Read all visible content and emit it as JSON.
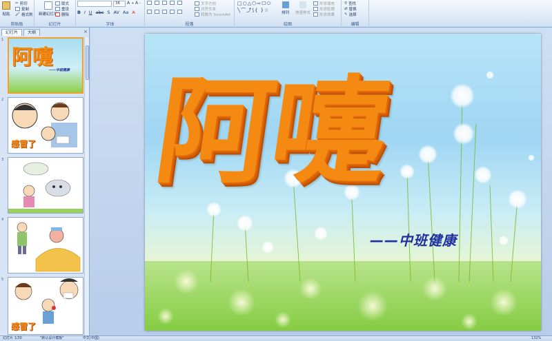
{
  "ribbon": {
    "groups": [
      {
        "label": "剪贴板",
        "items": [
          "粘贴",
          "剪切",
          "复制",
          "格式刷"
        ]
      },
      {
        "label": "幻灯片",
        "items": [
          "新建幻灯片",
          "版式",
          "重设",
          "删除"
        ]
      },
      {
        "label": "字体",
        "items": [
          "36"
        ]
      },
      {
        "label": "段落",
        "items": [
          "文字方向",
          "对齐文本",
          "转换为 SmartArt"
        ]
      },
      {
        "label": "绘图",
        "items": [
          "排列",
          "快速样式",
          "形状填充",
          "形状轮廓",
          "形状效果"
        ]
      },
      {
        "label": "编辑",
        "items": [
          "查找",
          "替换",
          "选择"
        ]
      }
    ]
  },
  "panel": {
    "tabs": [
      "幻灯片",
      "大纲"
    ],
    "close": "×",
    "thumbnails": [
      {
        "num": "1",
        "title": "阿嚏",
        "subtitle": "——中班健康",
        "selected": true
      },
      {
        "num": "2",
        "caption": "感冒了"
      },
      {
        "num": "3"
      },
      {
        "num": "4"
      },
      {
        "num": "5",
        "caption": "感冒了"
      }
    ]
  },
  "slide": {
    "title": "阿嚏",
    "subtitle": "——中班健康"
  },
  "status": {
    "slide_info": "幻灯片 1/30",
    "theme": "\"默认设计模板\"",
    "language": "中文(中国)",
    "zoom": "132%"
  },
  "colors": {
    "title": "#f58a12",
    "subtitle": "#1f2fa0",
    "ribbon": "#dde9f7",
    "selection": "#f0a12e"
  }
}
